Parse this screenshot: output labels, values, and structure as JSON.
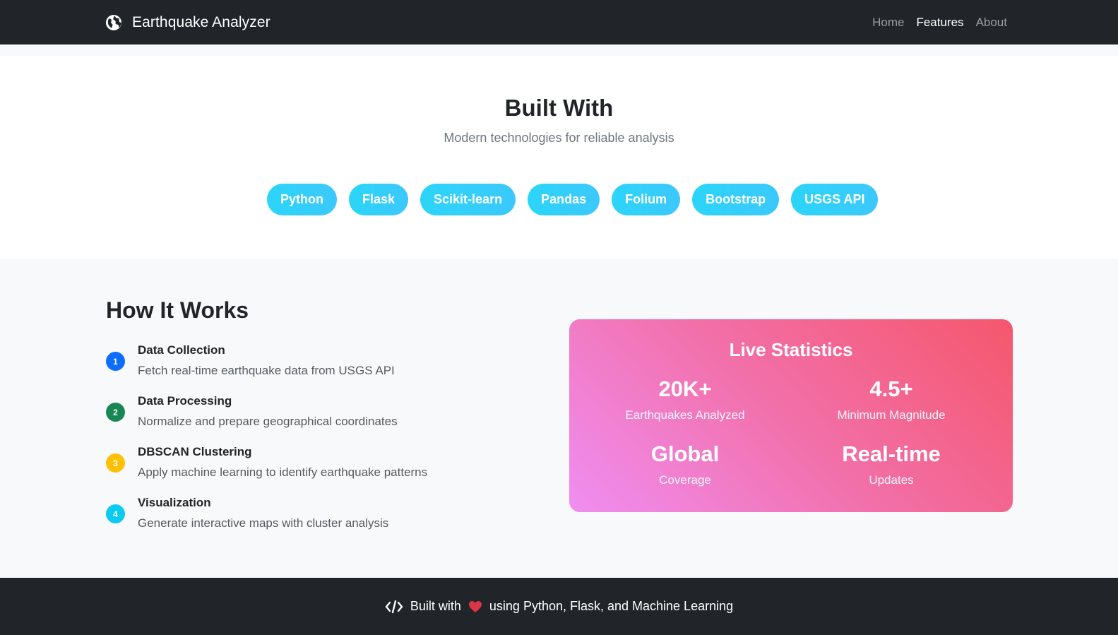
{
  "nav": {
    "brand_icon": "globe-icon",
    "brand": "Earthquake Analyzer",
    "links": [
      {
        "label": "Home",
        "active": false
      },
      {
        "label": "Features",
        "active": true
      },
      {
        "label": "About",
        "active": false
      }
    ]
  },
  "built_with": {
    "title": "Built With",
    "subtitle": "Modern technologies for reliable analysis",
    "badges": [
      "Python",
      "Flask",
      "Scikit-learn",
      "Pandas",
      "Folium",
      "Bootstrap",
      "USGS API"
    ]
  },
  "how": {
    "title": "How It Works",
    "steps": [
      {
        "num": "1",
        "title": "Data Collection",
        "desc": "Fetch real-time earthquake data from USGS API",
        "color": "#0d6efd"
      },
      {
        "num": "2",
        "title": "Data Processing",
        "desc": "Normalize and prepare geographical coordinates",
        "color": "#198754"
      },
      {
        "num": "3",
        "title": "DBSCAN Clustering",
        "desc": "Apply machine learning to identify earthquake patterns",
        "color": "#ffc107"
      },
      {
        "num": "4",
        "title": "Visualization",
        "desc": "Generate interactive maps with cluster analysis",
        "color": "#0dcaf0"
      }
    ]
  },
  "stats": {
    "title": "Live Statistics",
    "items": [
      {
        "value": "20K+",
        "label": "Earthquakes Analyzed"
      },
      {
        "value": "4.5+",
        "label": "Minimum Magnitude"
      },
      {
        "value": "Global",
        "label": "Coverage"
      },
      {
        "value": "Real-time",
        "label": "Updates"
      }
    ]
  },
  "footer": {
    "code_icon": "code-icon",
    "heart_icon": "heart-icon",
    "prefix": "Built with",
    "suffix": "using Python, Flask, and Machine Learning",
    "heart_color": "#dc3545"
  }
}
